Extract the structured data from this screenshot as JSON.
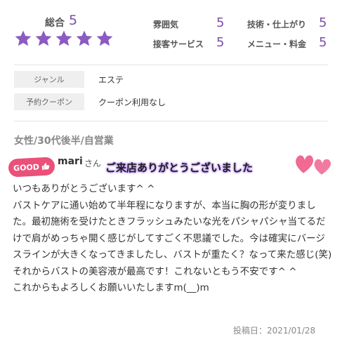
{
  "rating": {
    "overall_label": "総合",
    "overall_value": "5",
    "stars": 5,
    "categories": [
      {
        "label": "雰囲気",
        "value": "5"
      },
      {
        "label": "技術・仕上がり",
        "value": "5"
      },
      {
        "label": "接客サービス",
        "value": "5"
      },
      {
        "label": "メニュー・料金",
        "value": "5"
      }
    ]
  },
  "info": {
    "genre_label": "ジャンル",
    "genre_value": "エステ",
    "coupon_label": "予約クーポン",
    "coupon_value": "クーポン利用なし"
  },
  "review": {
    "reviewer_meta": "女性/30代後半/自営業",
    "good_badge": "GOOD",
    "username": "mari",
    "username_suffix": "さん",
    "reply_banner": "ご来店ありがとうございました",
    "body": "いつもありがとうございます^ ^\nバストケアに通い始めて半年程になりますが、本当に胸の形が変りました。最初施術を受けたときフラッシュみたいな光をパシャパシャ当てるだけで肩がめっちゃ開く感じがしてすごく不思議でした。今は確実にバージスラインが大きくなってきましたし、バストが重たく？なって来た感じ(笑)それからバストの美容液が最高です！これないともう不安です^ ^\nこれからもよろしくお願いいたしますm(__)m",
    "post_date": "投稿日：2021/01/28"
  },
  "colors": {
    "accent": "#7a4fa8",
    "star": "#8a5cc2",
    "badge": "#e9507a",
    "heart": "#f06a92"
  }
}
